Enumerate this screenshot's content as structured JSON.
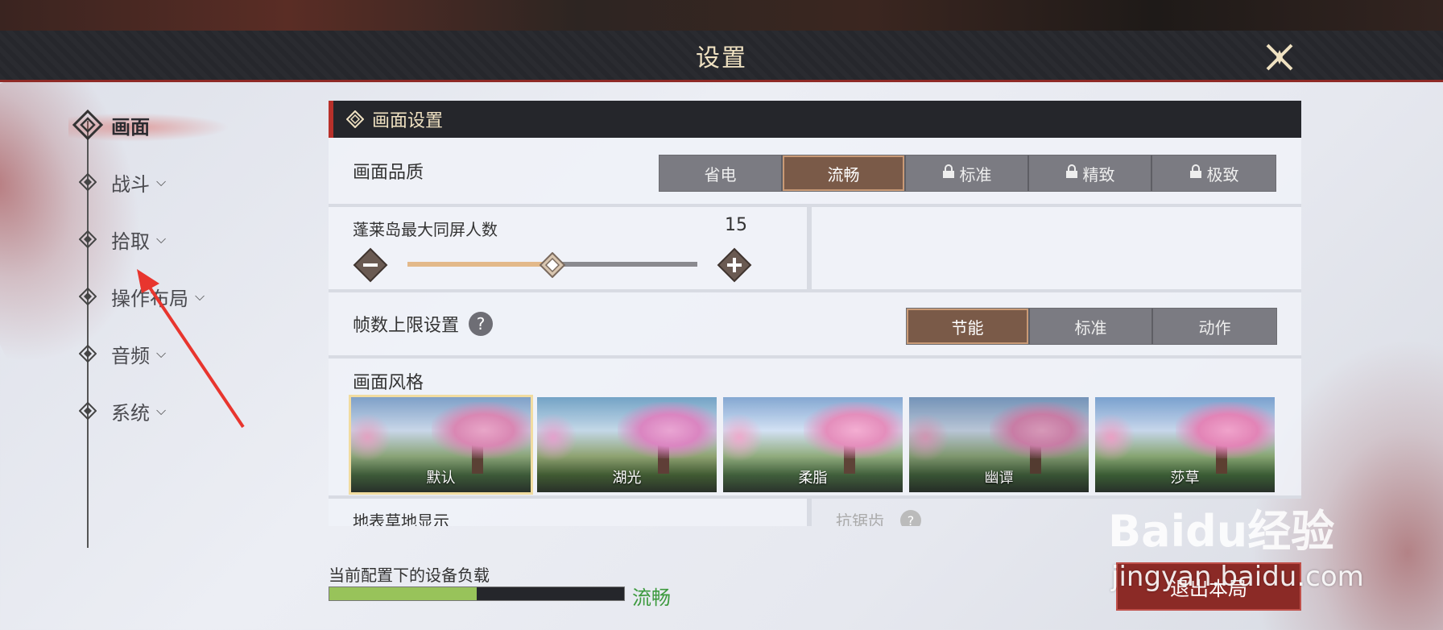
{
  "window": {
    "title": "设置"
  },
  "nav": {
    "items": [
      {
        "label": "画面",
        "active": true,
        "expandable": false
      },
      {
        "label": "战斗",
        "active": false,
        "expandable": true
      },
      {
        "label": "拾取",
        "active": false,
        "expandable": true
      },
      {
        "label": "操作布局",
        "active": false,
        "expandable": true
      },
      {
        "label": "音频",
        "active": false,
        "expandable": true
      },
      {
        "label": "系统",
        "active": false,
        "expandable": true
      }
    ]
  },
  "section": {
    "title": "画面设置"
  },
  "quality": {
    "label": "画面品质",
    "options": [
      {
        "label": "省电",
        "locked": false,
        "selected": false
      },
      {
        "label": "流畅",
        "locked": false,
        "selected": true
      },
      {
        "label": "标准",
        "locked": true,
        "selected": false
      },
      {
        "label": "精致",
        "locked": true,
        "selected": false
      },
      {
        "label": "极致",
        "locked": true,
        "selected": false
      }
    ]
  },
  "player_count": {
    "label": "蓬莱岛最大同屏人数",
    "value": "15",
    "slider_fraction": 0.5
  },
  "fps": {
    "label": "帧数上限设置",
    "help": "?",
    "options": [
      {
        "label": "节能",
        "selected": true
      },
      {
        "label": "标准",
        "selected": false
      },
      {
        "label": "动作",
        "selected": false
      }
    ]
  },
  "style": {
    "label": "画面风格",
    "options": [
      {
        "label": "默认",
        "selected": true
      },
      {
        "label": "湖光",
        "selected": false
      },
      {
        "label": "柔脂",
        "selected": false
      },
      {
        "label": "幽谭",
        "selected": false
      },
      {
        "label": "莎草",
        "selected": false
      }
    ]
  },
  "partial_row": {
    "left_label": "地表草地显示",
    "right_label": "抗锯齿",
    "right_help": "?"
  },
  "load": {
    "label": "当前配置下的设备负载",
    "status": "流畅",
    "fraction": 0.5,
    "status_color": "#3d9a3e"
  },
  "exit_button": {
    "label": "退出本局"
  },
  "watermark": {
    "text": "jingyan.baidu.com",
    "logo": "Baidu经验"
  },
  "colors": {
    "accent": "#b8302a",
    "selected": "#7a5a48",
    "title": "#f0e2c2"
  }
}
